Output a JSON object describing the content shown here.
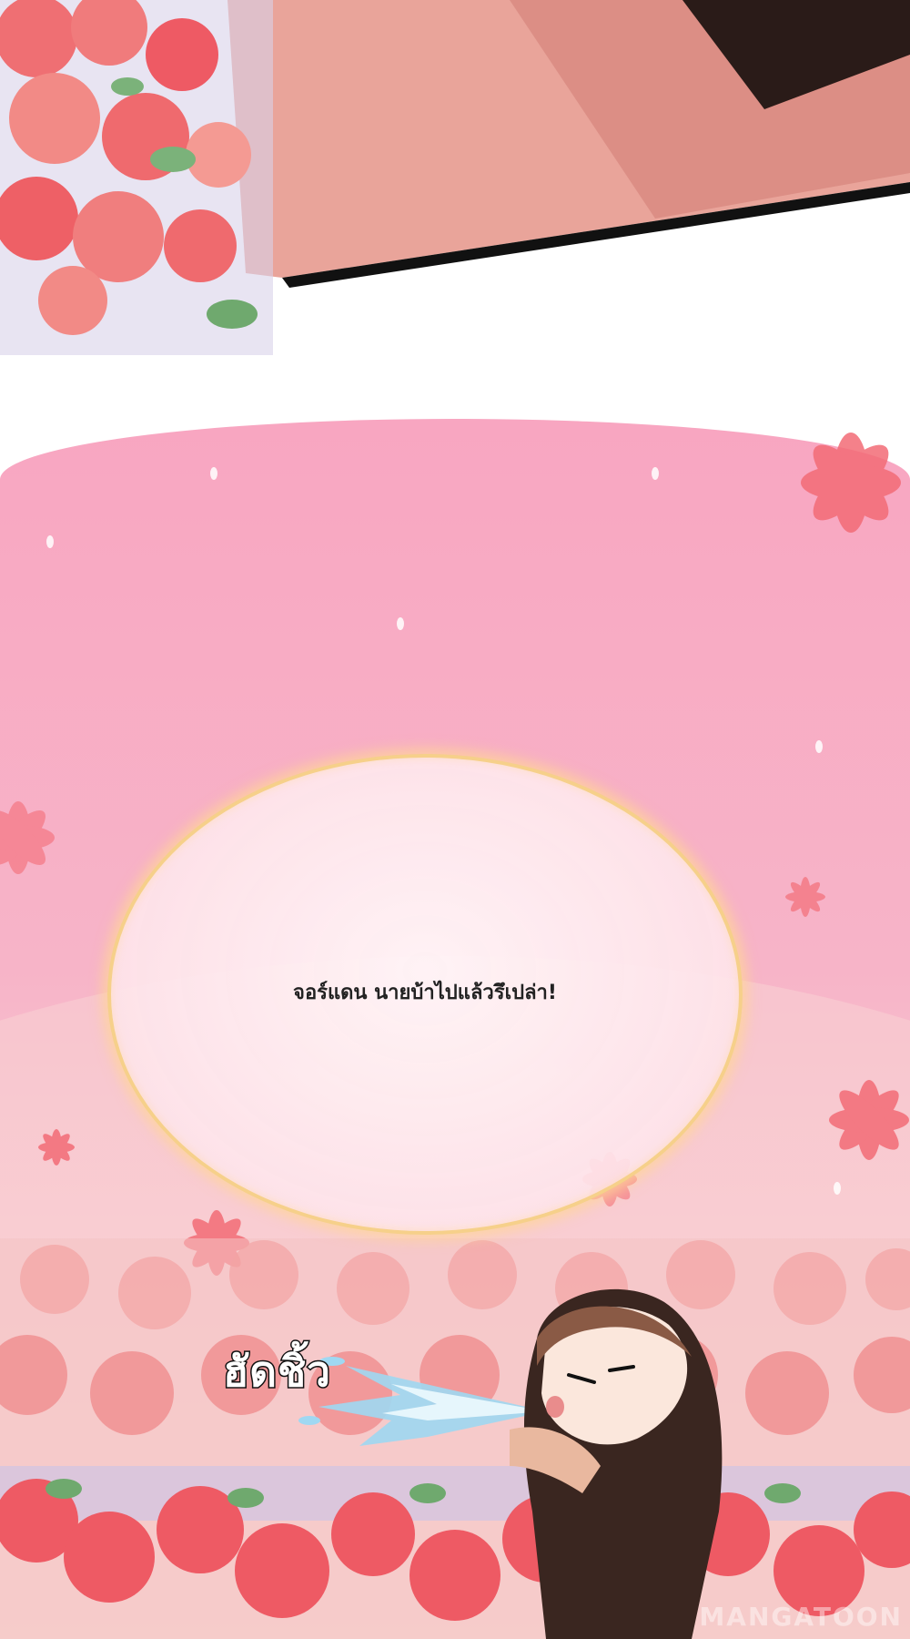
{
  "bubble": {
    "text": "จอร์แดน นายบ้าไปแล้วรึเปล่า!"
  },
  "sfx": {
    "text": "ฮัดชิ้ว"
  },
  "watermark": {
    "text": "MANGATOON"
  },
  "colors": {
    "pink_background": "#f8a6c1",
    "bubble_glow": "#f6d08a",
    "rose_red": "#ee5a64"
  }
}
